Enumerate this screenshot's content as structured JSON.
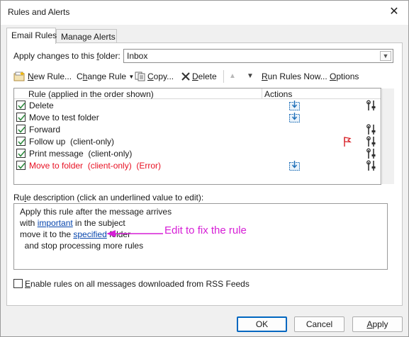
{
  "window": {
    "title": "Rules and Alerts"
  },
  "tabs": [
    {
      "label": "Email Rules",
      "active": true
    },
    {
      "label": "Manage Alerts",
      "active": false
    }
  ],
  "folder": {
    "label_before": "Apply changes to this ",
    "label_ul": "f",
    "label_after": "older:",
    "value": "Inbox"
  },
  "toolbar": {
    "new_rule_ul": "N",
    "new_rule_rest": "ew Rule...",
    "change_rule_pre": "C",
    "change_rule_ul": "h",
    "change_rule_rest": "ange Rule",
    "copy_ul": "C",
    "copy_rest": "opy...",
    "delete_ul": "D",
    "delete_rest": "elete",
    "run_rules_ul": "R",
    "run_rules_rest": "un Rules Now...",
    "options_ul": "O",
    "options_rest": "ptions"
  },
  "rules_list": {
    "col_rule": "Rule (applied in the order shown)",
    "col_actions": "Actions",
    "rows": [
      {
        "name": "Delete",
        "checked": true,
        "error": false,
        "move_icon": true,
        "settings_icon": true,
        "flag_icon": false
      },
      {
        "name": "Move to test folder",
        "checked": true,
        "error": false,
        "move_icon": true,
        "settings_icon": false,
        "flag_icon": false
      },
      {
        "name": "Forward",
        "checked": true,
        "error": false,
        "move_icon": false,
        "settings_icon": true,
        "flag_icon": false
      },
      {
        "name": "Follow up  (client-only)",
        "checked": true,
        "error": false,
        "move_icon": false,
        "settings_icon": true,
        "flag_icon": true
      },
      {
        "name": "Print message  (client-only)",
        "checked": true,
        "error": false,
        "move_icon": false,
        "settings_icon": true,
        "flag_icon": false
      },
      {
        "name": "Move to folder  (client-only)  (Error)",
        "checked": true,
        "error": true,
        "move_icon": true,
        "settings_icon": true,
        "flag_icon": false
      }
    ]
  },
  "description": {
    "label_pre": "Ru",
    "label_ul": "l",
    "label_rest": "e description (click an underlined value to edit):",
    "line1": "Apply this rule after the message arrives",
    "line2_pre": "with ",
    "line2_link": "important",
    "line2_post": " in the subject",
    "line3_pre": "move it to the ",
    "line3_link": "specified",
    "line3_post": " folder",
    "line4": "  and stop processing more rules",
    "annotation": "Edit to fix the rule"
  },
  "rss": {
    "ul": "E",
    "rest": "nable rules on all messages downloaded from RSS Feeds",
    "checked": false
  },
  "buttons": {
    "ok": "OK",
    "cancel": "Cancel",
    "apply_ul": "A",
    "apply_rest": "pply"
  },
  "colors": {
    "error": "#e81123",
    "annotation": "#d61fd6",
    "link": "#0645ad",
    "check": "#2e8b3e",
    "flag": "#d8232a"
  }
}
